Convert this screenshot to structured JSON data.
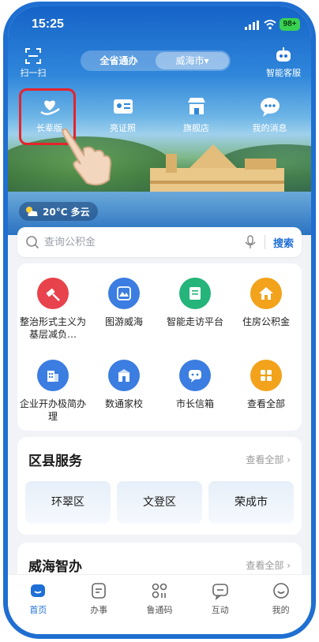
{
  "status_bar": {
    "time": "15:25",
    "battery": "98+"
  },
  "top_bar": {
    "scan_label": "扫一扫",
    "toggle": {
      "province": "全省通办",
      "city": "威海市▾"
    },
    "service_label": "智能客服"
  },
  "quick_actions": [
    {
      "label": "长辈版",
      "icon": "heart-hand-icon"
    },
    {
      "label": "亮证照",
      "icon": "id-card-icon"
    },
    {
      "label": "旗舰店",
      "icon": "store-icon"
    },
    {
      "label": "我的消息",
      "icon": "message-icon"
    }
  ],
  "weather": {
    "text": "20°C 多云",
    "icon": "partly-cloudy-icon"
  },
  "search": {
    "placeholder": "查询公积金",
    "button": "搜索"
  },
  "services": [
    {
      "label": "整治形式主义为基层减负…",
      "icon": "gavel-icon",
      "color": "#e8424c"
    },
    {
      "label": "图游威海",
      "icon": "map-tour-icon",
      "color": "#3b7de0"
    },
    {
      "label": "智能走访平台",
      "icon": "document-icon",
      "color": "#25b47a"
    },
    {
      "label": "住房公积金",
      "icon": "house-icon",
      "color": "#f2a21b"
    },
    {
      "label": "企业开办极简办理",
      "icon": "building-icon",
      "color": "#3b7de0"
    },
    {
      "label": "数通家校",
      "icon": "school-icon",
      "color": "#3b7de0"
    },
    {
      "label": "市长信箱",
      "icon": "chat-icon",
      "color": "#3b7de0"
    },
    {
      "label": "查看全部",
      "icon": "grid-icon",
      "color": "#f2a21b"
    }
  ],
  "district": {
    "title": "区县服务",
    "see_all": "查看全部 ›",
    "items": [
      "环翠区",
      "文登区",
      "荣成市"
    ]
  },
  "smart": {
    "title": "威海智办",
    "see_all": "查看全部 ›"
  },
  "tabs": [
    {
      "label": "首页",
      "icon": "home-icon",
      "active": true
    },
    {
      "label": "办事",
      "icon": "task-icon",
      "active": false
    },
    {
      "label": "鲁通码",
      "icon": "code-icon",
      "active": false
    },
    {
      "label": "互动",
      "icon": "interact-icon",
      "active": false
    },
    {
      "label": "我的",
      "icon": "profile-icon",
      "active": false
    }
  ]
}
